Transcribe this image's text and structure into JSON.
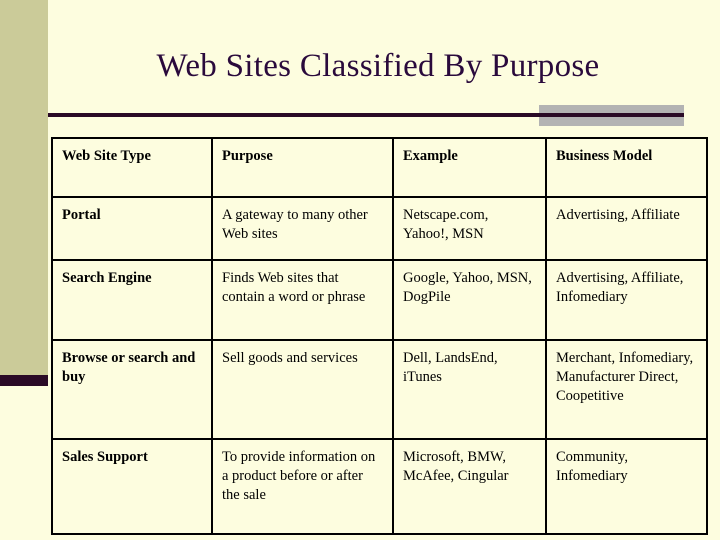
{
  "slide": {
    "title": "Web Sites Classified By Purpose",
    "background_color": "#fdfddf",
    "accent_band_color": "#cbcb99",
    "rule_color": "#2a0a26",
    "block_color": "#b3b3b3",
    "title_color": "#2a0a3c"
  },
  "table": {
    "headers": [
      "Web Site Type",
      "Purpose",
      "Example",
      "Business Model"
    ],
    "rows": [
      {
        "type": "Portal",
        "purpose": "A gateway to many other Web sites",
        "example": "Netscape.com, Yahoo!, MSN",
        "business_model": "Advertising, Affiliate"
      },
      {
        "type": "Search Engine",
        "purpose": "Finds Web sites that contain a word or phrase",
        "example": "Google, Yahoo, MSN, DogPile",
        "business_model": "Advertising, Affiliate, Infomediary"
      },
      {
        "type": "Browse or search and buy",
        "purpose": "Sell goods and services",
        "example": "Dell, LandsEnd, iTunes",
        "business_model": "Merchant, Infomediary, Manufacturer Direct, Coopetitive"
      },
      {
        "type": "Sales Support",
        "purpose": "To provide information on a product before or after the sale",
        "example": "Microsoft, BMW, McAfee, Cingular",
        "business_model": "Community, Infomediary"
      }
    ]
  }
}
